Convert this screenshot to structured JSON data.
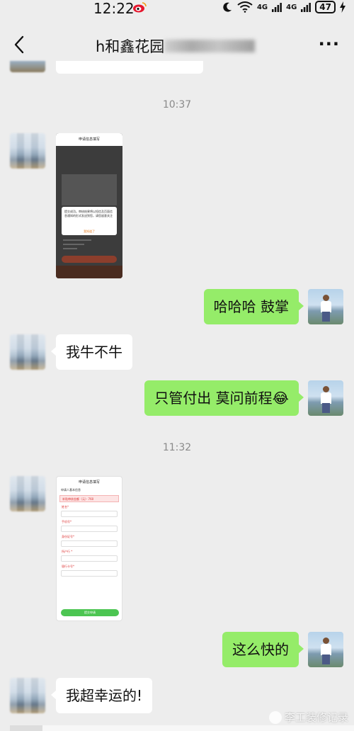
{
  "status_bar": {
    "time": "12:22",
    "network1": "4G",
    "network2": "4G",
    "battery": "47"
  },
  "header": {
    "title": "h和鑫花园",
    "more": "···"
  },
  "messages": {
    "time1": "10:37",
    "time2": "11:32",
    "m1": "哈哈哈 鼓掌",
    "m2": "我牛不牛",
    "m3": "只管付出 莫问前程😂",
    "m4": "这么快的",
    "m5": "我超幸运的!"
  },
  "shot1": {
    "header": "申请信息填写",
    "dialog": "提交成功。审核结果将以短信及页面信息通知的形式发送到您，请您留意关注",
    "ok": "我知道了"
  },
  "shot2": {
    "header": "申请信息填写",
    "section": "申请人基本信息",
    "banner": "补贴审核金额（元）· 760",
    "label1": "姓名*",
    "label2": "手机号*",
    "label3": "身份证号*",
    "label4": "所户行 *",
    "label5": "银行卡号*",
    "submit": "提交申请"
  },
  "watermark": "李工装修记录"
}
